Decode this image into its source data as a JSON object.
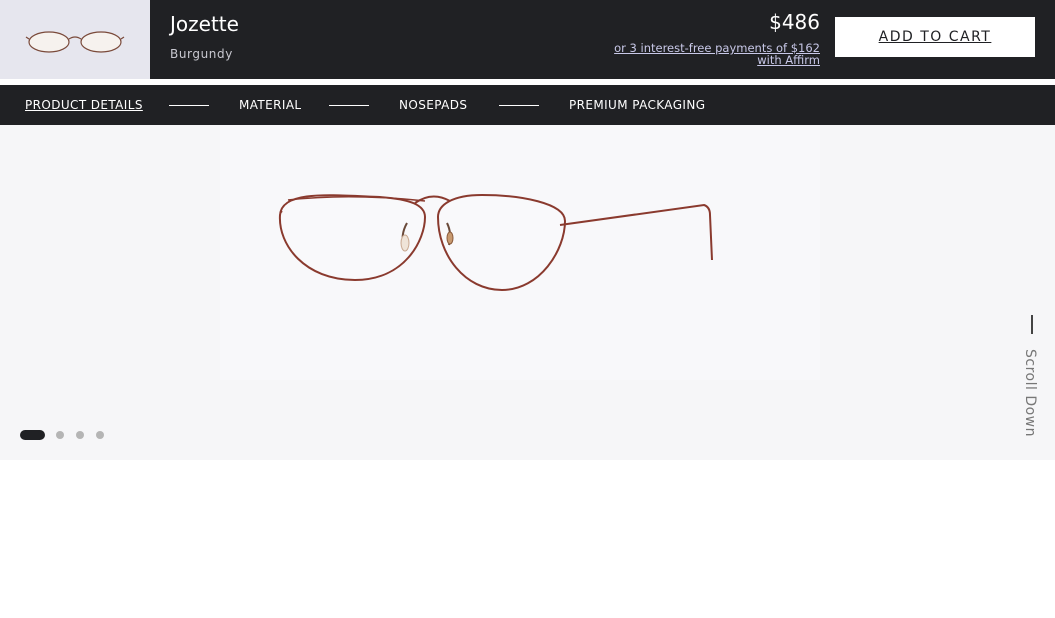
{
  "product": {
    "name": "Jozette",
    "color": "Burgundy",
    "price": "$486",
    "affirm_text": "or 3 interest-free payments of $162 with Affirm",
    "add_to_cart": "ADD TO CART"
  },
  "tabs": [
    {
      "label": "PRODUCT DETAILS",
      "active": true
    },
    {
      "label": "MATERIAL",
      "active": false
    },
    {
      "label": "NOSEPADS",
      "active": false
    },
    {
      "label": "PREMIUM PACKAGING",
      "active": false
    }
  ],
  "gallery": {
    "image_icon": "eyeglasses-image",
    "slide_count": 4,
    "active_slide": 1,
    "scroll_label": "Scroll Down"
  },
  "colors": {
    "dark_bar": "#202124",
    "frame": "#8a3a2e",
    "thumb_bg": "#e6e6ee"
  }
}
